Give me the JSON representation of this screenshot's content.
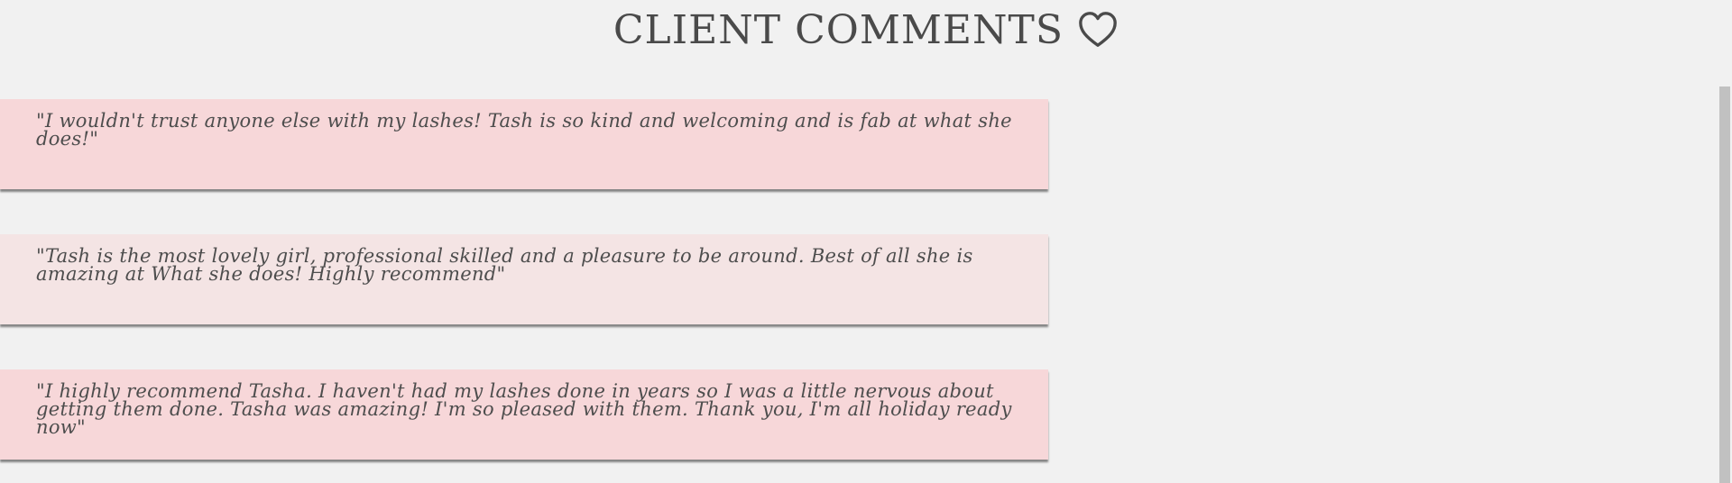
{
  "header": {
    "title": "CLIENT COMMENTS",
    "icon": "heart-icon"
  },
  "comments": [
    {
      "text": "\"I wouldn't trust anyone else with my lashes! Tash is so kind and welcoming and is fab at what she does!\"",
      "color": "#f7d7d9"
    },
    {
      "text": "\"Tash is the most lovely girl, professional skilled and a pleasure to be around. Best of all she is amazing at What she does! Highly recommend\"",
      "color": "#f4e4e4"
    },
    {
      "text": "\"I highly recommend Tasha. I haven't had my lashes done in years so I was a little nervous about getting them done. Tasha was amazing! I'm so pleased with them. Thank you, I'm all holiday ready now\"",
      "color": "#f7d7d9"
    }
  ]
}
